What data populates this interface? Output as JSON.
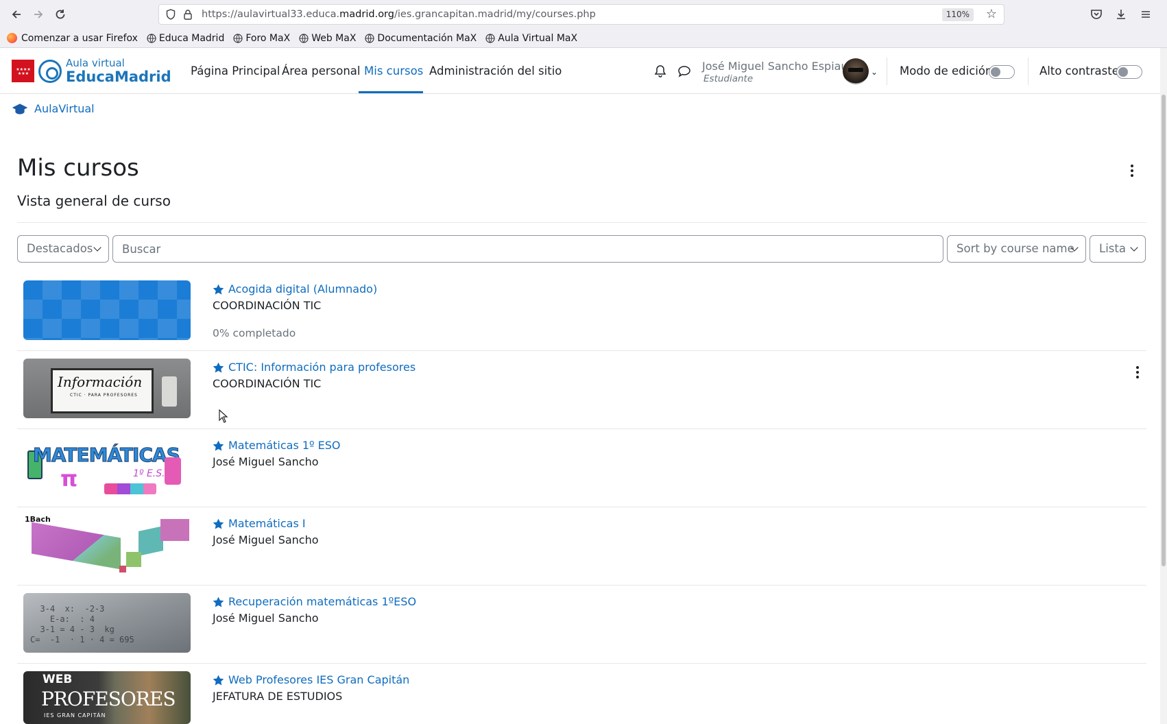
{
  "browser": {
    "url_prefix": "https://aulavirtual33.educa.",
    "url_domain": "madrid.org",
    "url_path": "/ies.grancapitan.madrid/my/courses.php",
    "zoom": "110%",
    "bookmarks": [
      {
        "label": "Comenzar a usar Firefox"
      },
      {
        "label": "Educa Madrid"
      },
      {
        "label": "Foro MaX"
      },
      {
        "label": "Web MaX"
      },
      {
        "label": "Documentación MaX"
      },
      {
        "label": "Aula Virtual MaX"
      }
    ]
  },
  "navbar": {
    "logo_small": "Aula virtual",
    "logo_big": "EducaMadrid",
    "menu": [
      {
        "label": "Página Principal"
      },
      {
        "label": "Área personal"
      },
      {
        "label": "Mis cursos"
      },
      {
        "label": "Administración del sitio"
      }
    ],
    "active_menu": "Mis cursos",
    "user_name": "José Miguel Sancho Espiau",
    "user_role": "Estudiante",
    "edit_mode_label": "Modo de edición",
    "contrast_label": "Alto contraste"
  },
  "breadcrumb": {
    "label": "AulaVirtual"
  },
  "page": {
    "title": "Mis cursos",
    "section_title": "Vista general de curso"
  },
  "filters": {
    "grouping": "Destacados",
    "search_placeholder": "Buscar",
    "sort": "Sort by course name",
    "view": "Lista"
  },
  "courses": [
    {
      "name": "Acogida digital (Alumnado)",
      "category": "COORDINACIÓN TIC",
      "progress": "0% completado"
    },
    {
      "name": "CTIC: Información para profesores",
      "category": "COORDINACIÓN TIC",
      "thumb_text": "Información",
      "thumb_sub": "CTIC · PARA PROFESORES"
    },
    {
      "name": "Matemáticas 1º ESO",
      "category": "José Miguel Sancho",
      "thumb_text": "MATEMÁTICAS",
      "thumb_sub": "1º E.S.O."
    },
    {
      "name": "Matemáticas I",
      "category": "José Miguel Sancho",
      "thumb_text": "1Bach"
    },
    {
      "name": "Recuperación matemáticas 1ºESO",
      "category": "José Miguel Sancho"
    },
    {
      "name": "Web Profesores IES Gran Capitán",
      "category": "JEFATURA DE ESTUDIOS",
      "thumb_web": "WEB",
      "thumb_text": "PROFESORES",
      "thumb_sub": "IES GRAN CAPITÁN"
    }
  ],
  "colors": {
    "link": "#0f6cbf",
    "brand": "#1b75bb",
    "flag_red": "#d2121f"
  }
}
